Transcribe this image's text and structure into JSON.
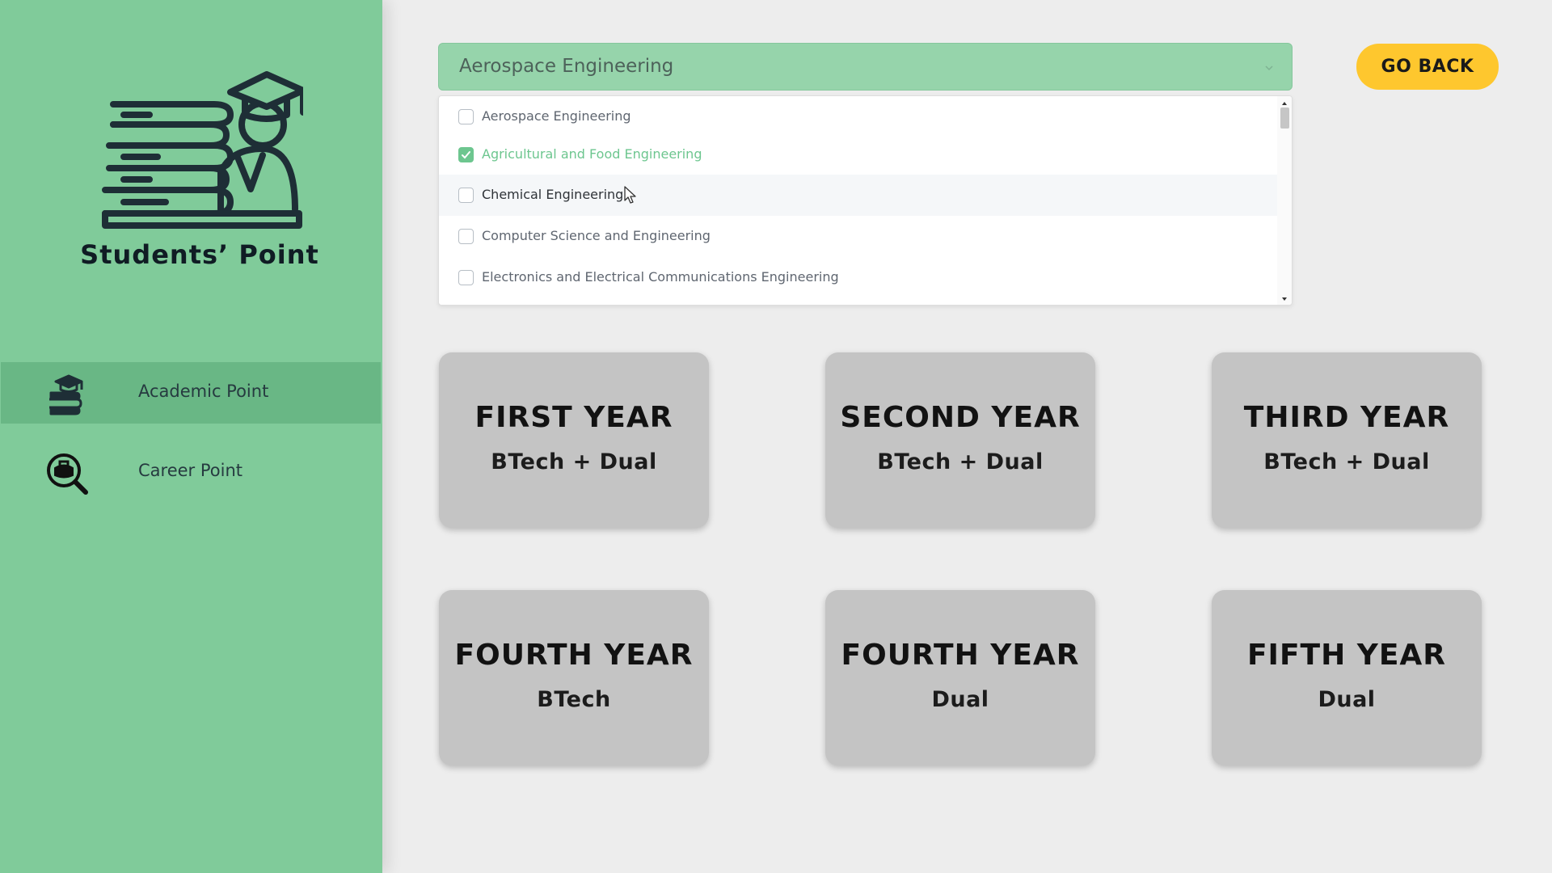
{
  "sidebar": {
    "brand": "Students’ Point",
    "items": [
      {
        "label": "Academic Point",
        "icon": "books-graduate-icon",
        "active": true
      },
      {
        "label": "Career Point",
        "icon": "career-search-icon",
        "active": false
      }
    ]
  },
  "branch_select": {
    "value": "Aerospace Engineering",
    "options": [
      {
        "label": "Aerospace Engineering",
        "checked": false
      },
      {
        "label": "Agricultural and Food Engineering",
        "checked": true
      },
      {
        "label": "Chemical Engineering",
        "checked": false,
        "hovered": true
      },
      {
        "label": "Computer Science and Engineering",
        "checked": false
      },
      {
        "label": "Electronics and Electrical Communications Engineering",
        "checked": false
      }
    ]
  },
  "go_back_label": "GO BACK",
  "cards": [
    {
      "title": "FIRST YEAR",
      "subtitle": "BTech + Dual"
    },
    {
      "title": "SECOND YEAR",
      "subtitle": "BTech + Dual"
    },
    {
      "title": "THIRD YEAR",
      "subtitle": "BTech + Dual"
    },
    {
      "title": "FOURTH YEAR",
      "subtitle": "BTech"
    },
    {
      "title": "FOURTH YEAR",
      "subtitle": "Dual"
    },
    {
      "title": "FIFTH YEAR",
      "subtitle": "Dual"
    }
  ],
  "colors": {
    "sidebar": "#80cb9a",
    "sidebar_active": "#69b785",
    "select_bg": "#96d4ab",
    "accent_check": "#6dc68f",
    "button": "#fec72e",
    "card": "#c4c4c4",
    "page_bg": "#ededed"
  }
}
